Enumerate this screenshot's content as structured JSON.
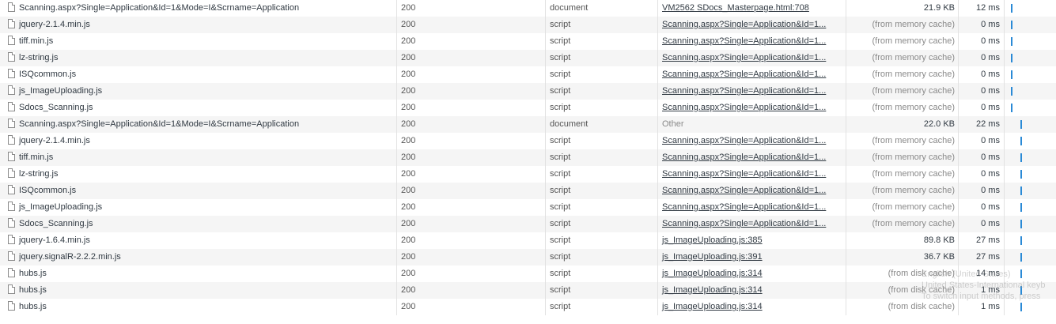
{
  "colors": {
    "accent_bar": "#2a8ad6",
    "row_alt": "#f5f5f5"
  },
  "requests": [
    {
      "name": "Scanning.aspx?Single=Application&Id=1&Mode=I&Scrname=Application",
      "icon": "document-icon",
      "status": "200",
      "type": "document",
      "initiator": "VM2562 SDocs_Masterpage.html:708",
      "initiator_link": true,
      "size": "21.9 KB",
      "size_cache": false,
      "time": "12 ms",
      "wf": 0.12
    },
    {
      "name": "jquery-2.1.4.min.js",
      "icon": "file-icon",
      "status": "200",
      "type": "script",
      "initiator": "Scanning.aspx?Single=Application&Id=1...",
      "initiator_link": true,
      "size": "(from memory cache)",
      "size_cache": true,
      "time": "0 ms",
      "wf": 0.12
    },
    {
      "name": "tiff.min.js",
      "icon": "file-icon",
      "status": "200",
      "type": "script",
      "initiator": "Scanning.aspx?Single=Application&Id=1...",
      "initiator_link": true,
      "size": "(from memory cache)",
      "size_cache": true,
      "time": "0 ms",
      "wf": 0.12
    },
    {
      "name": "lz-string.js",
      "icon": "file-icon",
      "status": "200",
      "type": "script",
      "initiator": "Scanning.aspx?Single=Application&Id=1...",
      "initiator_link": true,
      "size": "(from memory cache)",
      "size_cache": true,
      "time": "0 ms",
      "wf": 0.12
    },
    {
      "name": "ISQcommon.js",
      "icon": "file-icon",
      "status": "200",
      "type": "script",
      "initiator": "Scanning.aspx?Single=Application&Id=1...",
      "initiator_link": true,
      "size": "(from memory cache)",
      "size_cache": true,
      "time": "0 ms",
      "wf": 0.12
    },
    {
      "name": "js_ImageUploading.js",
      "icon": "file-icon",
      "status": "200",
      "type": "script",
      "initiator": "Scanning.aspx?Single=Application&Id=1...",
      "initiator_link": true,
      "size": "(from memory cache)",
      "size_cache": true,
      "time": "0 ms",
      "wf": 0.12
    },
    {
      "name": "Sdocs_Scanning.js",
      "icon": "file-icon",
      "status": "200",
      "type": "script",
      "initiator": "Scanning.aspx?Single=Application&Id=1...",
      "initiator_link": true,
      "size": "(from memory cache)",
      "size_cache": true,
      "time": "0 ms",
      "wf": 0.12
    },
    {
      "name": "Scanning.aspx?Single=Application&Id=1&Mode=I&Scrname=Application",
      "icon": "document-icon",
      "status": "200",
      "type": "document",
      "initiator": "Other",
      "initiator_link": false,
      "size": "22.0 KB",
      "size_cache": false,
      "time": "22 ms",
      "wf": 0.3
    },
    {
      "name": "jquery-2.1.4.min.js",
      "icon": "file-icon",
      "status": "200",
      "type": "script",
      "initiator": "Scanning.aspx?Single=Application&Id=1...",
      "initiator_link": true,
      "size": "(from memory cache)",
      "size_cache": true,
      "time": "0 ms",
      "wf": 0.3
    },
    {
      "name": "tiff.min.js",
      "icon": "file-icon",
      "status": "200",
      "type": "script",
      "initiator": "Scanning.aspx?Single=Application&Id=1...",
      "initiator_link": true,
      "size": "(from memory cache)",
      "size_cache": true,
      "time": "0 ms",
      "wf": 0.3
    },
    {
      "name": "lz-string.js",
      "icon": "file-icon",
      "status": "200",
      "type": "script",
      "initiator": "Scanning.aspx?Single=Application&Id=1...",
      "initiator_link": true,
      "size": "(from memory cache)",
      "size_cache": true,
      "time": "0 ms",
      "wf": 0.3
    },
    {
      "name": "ISQcommon.js",
      "icon": "file-icon",
      "status": "200",
      "type": "script",
      "initiator": "Scanning.aspx?Single=Application&Id=1...",
      "initiator_link": true,
      "size": "(from memory cache)",
      "size_cache": true,
      "time": "0 ms",
      "wf": 0.3
    },
    {
      "name": "js_ImageUploading.js",
      "icon": "file-icon",
      "status": "200",
      "type": "script",
      "initiator": "Scanning.aspx?Single=Application&Id=1...",
      "initiator_link": true,
      "size": "(from memory cache)",
      "size_cache": true,
      "time": "0 ms",
      "wf": 0.3
    },
    {
      "name": "Sdocs_Scanning.js",
      "icon": "file-icon",
      "status": "200",
      "type": "script",
      "initiator": "Scanning.aspx?Single=Application&Id=1...",
      "initiator_link": true,
      "size": "(from memory cache)",
      "size_cache": true,
      "time": "0 ms",
      "wf": 0.3
    },
    {
      "name": "jquery-1.6.4.min.js",
      "icon": "file-icon",
      "status": "200",
      "type": "script",
      "initiator": "js_ImageUploading.js:385",
      "initiator_link": true,
      "size": "89.8 KB",
      "size_cache": false,
      "time": "27 ms",
      "wf": 0.3
    },
    {
      "name": "jquery.signalR-2.2.2.min.js",
      "icon": "file-icon",
      "status": "200",
      "type": "script",
      "initiator": "js_ImageUploading.js:391",
      "initiator_link": true,
      "size": "36.7 KB",
      "size_cache": false,
      "time": "27 ms",
      "wf": 0.3
    },
    {
      "name": "hubs.js",
      "icon": "file-icon",
      "status": "200",
      "type": "script",
      "initiator": "js_ImageUploading.js:314",
      "initiator_link": true,
      "size": "(from disk cache)",
      "size_cache": true,
      "time": "14 ms",
      "wf": 0.3
    },
    {
      "name": "hubs.js",
      "icon": "file-icon",
      "status": "200",
      "type": "script",
      "initiator": "js_ImageUploading.js:314",
      "initiator_link": true,
      "size": "(from disk cache)",
      "size_cache": true,
      "time": "1 ms",
      "wf": 0.3
    },
    {
      "name": "hubs.js",
      "icon": "file-icon",
      "status": "200",
      "type": "script",
      "initiator": "js_ImageUploading.js:314",
      "initiator_link": true,
      "size": "(from disk cache)",
      "size_cache": true,
      "time": "1 ms",
      "wf": 0.3
    }
  ],
  "ime_overlay": {
    "line1": "English (United States)",
    "line2": "United States-International keyb",
    "line3": "To switch input methods, press"
  }
}
